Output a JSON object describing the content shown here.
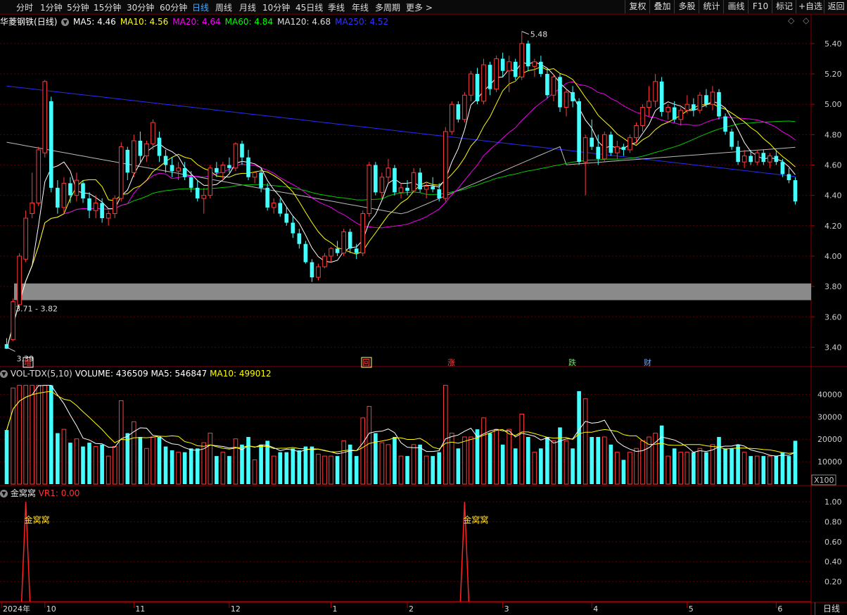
{
  "toolbar": {
    "periods": [
      "分时",
      "1分钟",
      "5分钟",
      "15分钟",
      "30分钟",
      "60分钟",
      "日线",
      "周线",
      "月线",
      "10分钟",
      "45日线",
      "季线",
      "年线",
      "多周期",
      "更多 >"
    ],
    "active_period": "日线",
    "right_buttons": [
      "复权",
      "叠加",
      "多股",
      "统计",
      "画线",
      "F10",
      "标记",
      "+自选",
      "返回"
    ]
  },
  "main_panel": {
    "stock": "华菱钢铁",
    "period": "(日线)",
    "ma": [
      {
        "label": "MA5: 4.46",
        "color": "#ffffff"
      },
      {
        "label": "MA10: 4.56",
        "color": "#ffff00"
      },
      {
        "label": "MA20: 4.64",
        "color": "#ff00ff"
      },
      {
        "label": "MA60: 4.84",
        "color": "#00ff00"
      },
      {
        "label": "MA120: 4.68",
        "color": "#dddddd"
      },
      {
        "label": "MA250: 4.52",
        "color": "#3333ff"
      }
    ],
    "price_labels": [
      "5.40",
      "5.20",
      "5.00",
      "4.80",
      "4.60",
      "4.40",
      "4.20",
      "4.00",
      "3.80",
      "3.60",
      "3.40"
    ],
    "high_marker": "5.48",
    "low_marker": "3.39",
    "range_label": "3.71 - 3.82",
    "events": [
      {
        "text": "增",
        "color": "#ff4444",
        "box": "#ffffff"
      },
      {
        "text": "回",
        "color": "#ff4444",
        "box": "#ffff66"
      },
      {
        "text": "涨",
        "color": "#ff4444",
        "box": null
      },
      {
        "text": "跌",
        "color": "#44ff44",
        "box": null
      },
      {
        "text": "财",
        "color": "#66aaff",
        "box": null
      }
    ]
  },
  "volume_panel": {
    "title": "VOL-TDX(5,10)",
    "volume": "VOLUME: 436509",
    "ma5": "MA5: 546847",
    "ma10": "MA10: 499012",
    "labels": [
      "40000",
      "30000",
      "20000",
      "10000"
    ],
    "unit": "X100"
  },
  "indicator_panel": {
    "title": "金窝窝",
    "vr": "VR1: 0.00",
    "labels": [
      "1.00",
      "0.80",
      "0.60",
      "0.40",
      "0.20"
    ],
    "signal_text": "金窝窝"
  },
  "time_axis": {
    "labels": [
      "2024年",
      "10",
      "11",
      "12",
      "1",
      "2",
      "3",
      "4",
      "5",
      "6"
    ],
    "button": "日线"
  },
  "chart_data": {
    "type": "candlestick",
    "title": "",
    "y_range": [
      3.3,
      5.52
    ],
    "bars": [
      [
        3.42,
        3.46,
        3.4,
        3.39
      ],
      [
        3.45,
        3.72,
        3.44,
        3.7
      ],
      [
        3.68,
        4.02,
        3.65,
        4.0
      ],
      [
        3.98,
        4.3,
        3.96,
        4.25
      ],
      [
        4.28,
        4.55,
        4.25,
        4.35
      ],
      [
        4.35,
        4.72,
        4.33,
        4.7
      ],
      [
        4.68,
        5.16,
        4.65,
        5.15
      ],
      [
        5.02,
        5.05,
        4.42,
        4.45
      ],
      [
        4.45,
        4.5,
        4.28,
        4.32
      ],
      [
        4.32,
        4.52,
        4.28,
        4.48
      ],
      [
        4.48,
        4.52,
        4.35,
        4.4
      ],
      [
        4.4,
        4.55,
        4.36,
        4.5
      ],
      [
        4.48,
        4.5,
        4.35,
        4.38
      ],
      [
        4.38,
        4.42,
        4.25,
        4.3
      ],
      [
        4.3,
        4.4,
        4.25,
        4.35
      ],
      [
        4.35,
        4.38,
        4.22,
        4.25
      ],
      [
        4.25,
        4.3,
        4.2,
        4.28
      ],
      [
        4.28,
        4.4,
        4.25,
        4.38
      ],
      [
        4.38,
        4.75,
        4.36,
        4.72
      ],
      [
        4.7,
        4.72,
        4.5,
        4.55
      ],
      [
        4.55,
        4.8,
        4.52,
        4.76
      ],
      [
        4.76,
        4.82,
        4.62,
        4.66
      ],
      [
        4.66,
        4.76,
        4.62,
        4.74
      ],
      [
        4.74,
        4.9,
        4.7,
        4.88
      ],
      [
        4.78,
        4.82,
        4.62,
        4.66
      ],
      [
        4.66,
        4.7,
        4.55,
        4.6
      ],
      [
        4.6,
        4.65,
        4.52,
        4.56
      ],
      [
        4.56,
        4.62,
        4.5,
        4.58
      ],
      [
        4.58,
        4.62,
        4.5,
        4.52
      ],
      [
        4.52,
        4.56,
        4.42,
        4.45
      ],
      [
        4.45,
        4.5,
        4.36,
        4.38
      ],
      [
        4.38,
        4.45,
        4.28,
        4.4
      ],
      [
        4.4,
        4.6,
        4.38,
        4.58
      ],
      [
        4.58,
        4.62,
        4.52,
        4.55
      ],
      [
        4.55,
        4.62,
        4.5,
        4.6
      ],
      [
        4.6,
        4.65,
        4.55,
        4.58
      ],
      [
        4.58,
        4.75,
        4.56,
        4.74
      ],
      [
        4.74,
        4.76,
        4.6,
        4.65
      ],
      [
        4.65,
        4.7,
        4.5,
        4.52
      ],
      [
        4.52,
        4.56,
        4.48,
        4.55
      ],
      [
        4.55,
        4.58,
        4.42,
        4.45
      ],
      [
        4.45,
        4.48,
        4.3,
        4.32
      ],
      [
        4.32,
        4.38,
        4.28,
        4.35
      ],
      [
        4.35,
        4.38,
        4.26,
        4.28
      ],
      [
        4.28,
        4.32,
        4.2,
        4.22
      ],
      [
        4.22,
        4.26,
        4.12,
        4.15
      ],
      [
        4.15,
        4.18,
        4.05,
        4.08
      ],
      [
        4.08,
        4.1,
        3.95,
        3.96
      ],
      [
        3.96,
        3.98,
        3.83,
        3.86
      ],
      [
        3.86,
        3.95,
        3.84,
        3.93
      ],
      [
        3.93,
        4.02,
        3.92,
        4.0
      ],
      [
        4.0,
        4.06,
        3.96,
        4.05
      ],
      [
        4.05,
        4.1,
        4.0,
        4.02
      ],
      [
        4.02,
        4.18,
        4.0,
        4.16
      ],
      [
        4.16,
        4.18,
        4.02,
        4.05
      ],
      [
        4.05,
        4.08,
        3.98,
        4.02
      ],
      [
        4.02,
        4.3,
        4.0,
        4.28
      ],
      [
        4.28,
        4.62,
        4.26,
        4.6
      ],
      [
        4.6,
        4.62,
        4.4,
        4.42
      ],
      [
        4.42,
        4.55,
        4.38,
        4.52
      ],
      [
        4.52,
        4.64,
        4.48,
        4.58
      ],
      [
        4.58,
        4.6,
        4.4,
        4.42
      ],
      [
        4.42,
        4.48,
        4.38,
        4.45
      ],
      [
        4.45,
        4.5,
        4.4,
        4.43
      ],
      [
        4.43,
        4.58,
        4.42,
        4.55
      ],
      [
        4.55,
        4.58,
        4.42,
        4.44
      ],
      [
        4.44,
        4.48,
        4.38,
        4.46
      ],
      [
        4.46,
        4.52,
        4.42,
        4.44
      ],
      [
        4.44,
        4.48,
        4.36,
        4.38
      ],
      [
        4.38,
        4.85,
        4.36,
        4.82
      ],
      [
        4.82,
        5.02,
        4.8,
        5.0
      ],
      [
        5.0,
        5.02,
        4.88,
        4.9
      ],
      [
        4.9,
        5.08,
        4.88,
        5.06
      ],
      [
        5.06,
        5.22,
        5.02,
        5.2
      ],
      [
        5.2,
        5.24,
        5.0,
        5.02
      ],
      [
        5.02,
        5.3,
        5.0,
        5.26
      ],
      [
        5.26,
        5.28,
        5.06,
        5.1
      ],
      [
        5.1,
        5.32,
        5.08,
        5.3
      ],
      [
        5.3,
        5.34,
        5.18,
        5.22
      ],
      [
        5.22,
        5.32,
        5.08,
        5.28
      ],
      [
        5.28,
        5.3,
        5.16,
        5.18
      ],
      [
        5.18,
        5.48,
        5.16,
        5.4
      ],
      [
        5.4,
        5.42,
        5.22,
        5.25
      ],
      [
        5.25,
        5.3,
        5.18,
        5.28
      ],
      [
        5.28,
        5.32,
        5.18,
        5.2
      ],
      [
        5.2,
        5.24,
        5.04,
        5.06
      ],
      [
        5.06,
        5.2,
        5.02,
        5.18
      ],
      [
        5.18,
        5.2,
        4.95,
        4.98
      ],
      [
        4.98,
        5.1,
        4.92,
        5.08
      ],
      [
        5.08,
        5.12,
        4.98,
        5.02
      ],
      [
        5.02,
        5.04,
        4.6,
        4.62
      ],
      [
        4.62,
        4.8,
        4.4,
        4.78
      ],
      [
        4.78,
        4.9,
        4.7,
        4.72
      ],
      [
        4.72,
        4.8,
        4.6,
        4.64
      ],
      [
        4.64,
        4.82,
        4.62,
        4.8
      ],
      [
        4.8,
        4.82,
        4.66,
        4.68
      ],
      [
        4.68,
        4.76,
        4.64,
        4.72
      ],
      [
        4.72,
        4.74,
        4.66,
        4.7
      ],
      [
        4.7,
        4.8,
        4.68,
        4.78
      ],
      [
        4.78,
        4.88,
        4.74,
        4.86
      ],
      [
        4.86,
        5.0,
        4.82,
        4.98
      ],
      [
        4.98,
        5.12,
        4.92,
        5.02
      ],
      [
        5.02,
        5.2,
        4.98,
        5.15
      ],
      [
        5.15,
        5.18,
        4.92,
        4.95
      ],
      [
        4.95,
        5.0,
        4.9,
        4.98
      ],
      [
        4.98,
        5.02,
        4.88,
        4.9
      ],
      [
        4.9,
        4.98,
        4.86,
        4.96
      ],
      [
        4.96,
        5.06,
        4.94,
        5.0
      ],
      [
        5.0,
        5.04,
        4.92,
        4.96
      ],
      [
        4.96,
        5.08,
        4.94,
        5.06
      ],
      [
        5.06,
        5.1,
        4.98,
        5.0
      ],
      [
        5.0,
        5.12,
        4.96,
        5.08
      ],
      [
        5.08,
        5.1,
        4.9,
        4.92
      ],
      [
        4.92,
        4.94,
        4.8,
        4.82
      ],
      [
        4.82,
        4.84,
        4.7,
        4.72
      ],
      [
        4.72,
        4.76,
        4.6,
        4.62
      ],
      [
        4.62,
        4.7,
        4.58,
        4.66
      ],
      [
        4.66,
        4.7,
        4.6,
        4.62
      ],
      [
        4.62,
        4.7,
        4.6,
        4.68
      ],
      [
        4.68,
        4.7,
        4.6,
        4.62
      ],
      [
        4.62,
        4.68,
        4.58,
        4.66
      ],
      [
        4.66,
        4.7,
        4.6,
        4.62
      ],
      [
        4.62,
        4.64,
        4.52,
        4.54
      ],
      [
        4.54,
        4.58,
        4.48,
        4.5
      ],
      [
        4.5,
        4.52,
        4.34,
        4.36
      ]
    ],
    "signals": [
      3,
      72
    ]
  }
}
